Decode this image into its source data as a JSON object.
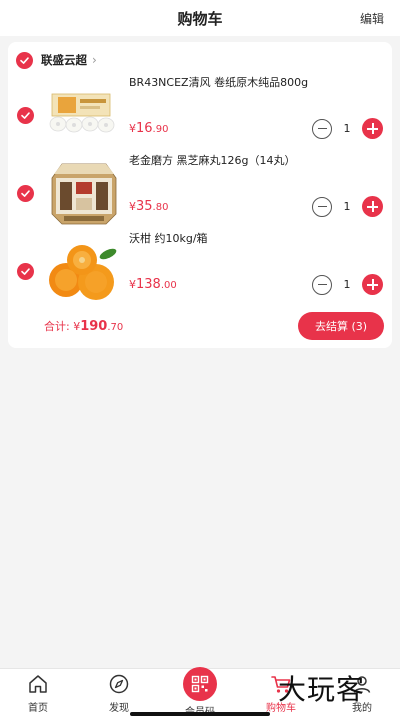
{
  "header": {
    "title": "购物车",
    "edit_label": "编辑"
  },
  "store": {
    "name": "联盛云超"
  },
  "items": [
    {
      "name": "BR43NCEZ清风 卷纸原木纯品800g",
      "currency": "¥",
      "price_int": "16",
      "price_dec": ".90",
      "qty": "1"
    },
    {
      "name": "老金磨方 黑芝麻丸126g（14丸）",
      "currency": "¥",
      "price_int": "35",
      "price_dec": ".80",
      "qty": "1"
    },
    {
      "name": "沃柑 约10kg/箱",
      "currency": "¥",
      "price_int": "138",
      "price_dec": ".00",
      "qty": "1"
    }
  ],
  "footer": {
    "total_label": "合计:",
    "currency": "¥",
    "total_int": "190",
    "total_dec": ".70",
    "checkout_label": "去结算 (3)"
  },
  "tabbar": {
    "tabs": [
      {
        "label": "首页",
        "icon": "home-icon"
      },
      {
        "label": "发现",
        "icon": "compass-icon"
      },
      {
        "label": "会员码",
        "icon": "qr-code-icon"
      },
      {
        "label": "购物车",
        "icon": "cart-icon"
      },
      {
        "label": "我的",
        "icon": "user-icon"
      }
    ]
  },
  "watermark": "大玩客",
  "colors": {
    "accent": "#e8334a",
    "background": "#f4f4f4"
  }
}
